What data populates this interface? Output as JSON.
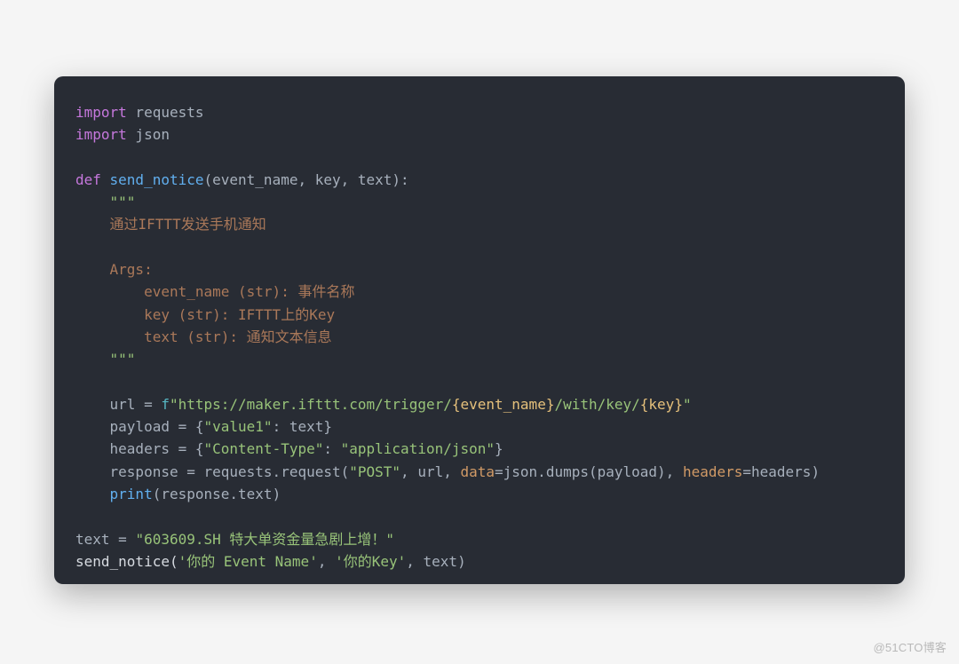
{
  "watermark": "@51CTO博客",
  "code": {
    "l1": {
      "kw": "import",
      "mod": " requests"
    },
    "l2": {
      "kw": "import",
      "mod": " json"
    },
    "l3": "",
    "l4": {
      "kw": "def ",
      "fn": "send_notice",
      "sig": "(event_name, key, text):"
    },
    "l5": {
      "indent": "    ",
      "q": "\"\"\""
    },
    "l6": {
      "indent": "    ",
      "txt": "通过IFTTT发送手机通知"
    },
    "l7": "",
    "l8": {
      "indent": "    ",
      "txt": "Args:"
    },
    "l9": {
      "indent": "        ",
      "txt": "event_name (str): 事件名称"
    },
    "l10": {
      "indent": "        ",
      "txt": "key (str): IFTTT上的Key"
    },
    "l11": {
      "indent": "        ",
      "txt": "text (str): 通知文本信息"
    },
    "l12": {
      "indent": "    ",
      "q": "\"\"\""
    },
    "l13": "",
    "l14": {
      "indent": "    ",
      "lhs": "url = ",
      "f": "f",
      "s1": "\"https://maker.ifttt.com/trigger/",
      "i1": "{event_name}",
      "s2": "/with/key/",
      "i2": "{key}",
      "s3": "\""
    },
    "l15": {
      "indent": "    ",
      "a": "payload = {",
      "k": "\"value1\"",
      "b": ": text}"
    },
    "l16": {
      "indent": "    ",
      "a": "headers = {",
      "k": "\"Content-Type\"",
      "b": ": ",
      "v": "\"application/json\"",
      "c": "}"
    },
    "l17": {
      "indent": "    ",
      "a": "response = requests.request(",
      "post": "\"POST\"",
      "b": ", url, ",
      "n1": "data",
      "c": "=json.dumps(payload), ",
      "n2": "headers",
      "d": "=headers)"
    },
    "l18": {
      "indent": "    ",
      "fn": "print",
      "rest": "(response.text)"
    },
    "l19": "",
    "l20": {
      "a": "text = ",
      "s": "\"603609.SH 特大单资金量急剧上增！\""
    },
    "l21": {
      "a": "send_notice(",
      "s1": "'你的 Event Name'",
      "b": ", ",
      "s2": "'你的Key'",
      "c": ", text)"
    }
  }
}
